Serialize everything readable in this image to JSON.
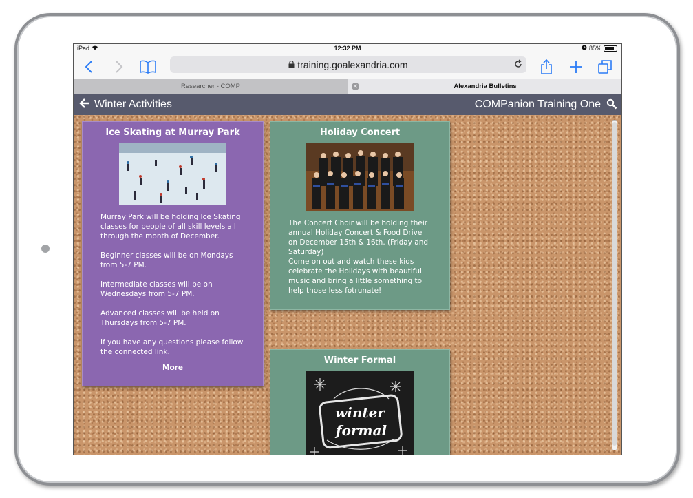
{
  "statusbar": {
    "device": "iPad",
    "time": "12:32 PM",
    "battery": "85%"
  },
  "browser": {
    "url": "training.goalexandria.com",
    "tabs": [
      {
        "label": "Researcher - COMP"
      },
      {
        "label": "Alexandria Bulletins"
      }
    ]
  },
  "header": {
    "title": "Winter Activities",
    "right_title": "COMPanion Training One"
  },
  "cards": [
    {
      "title": "Ice Skating at Murray Park",
      "body": "Murray Park will be holding Ice Skating classes for people of all skill levels all through the month of December.\n\nBeginner classes will be on Mondays from 5-7 PM.\n\nIntermediate classes will be on Wednesdays from 5-7 PM.\n\nAdvanced classes will be held on Thursdays from 5-7 PM.\n\nIf you have any questions please follow the connected link.",
      "link": "More"
    },
    {
      "title": "Holiday Concert",
      "body": "The Concert Choir will be holding their annual Holiday Concert & Food Drive on December 15th & 16th. (Friday and Saturday)\nCome on out and watch these kids celebrate the Holidays with beautiful music and bring a little something to help those less fotrunate!"
    },
    {
      "title": "Winter Formal",
      "image_text_1": "winter",
      "image_text_2": "formal"
    }
  ],
  "colors": {
    "purple_card": "#8b67b0",
    "green_card": "#6d9a86",
    "header_bar": "#575a6d",
    "accent": "#2b7cf6"
  }
}
